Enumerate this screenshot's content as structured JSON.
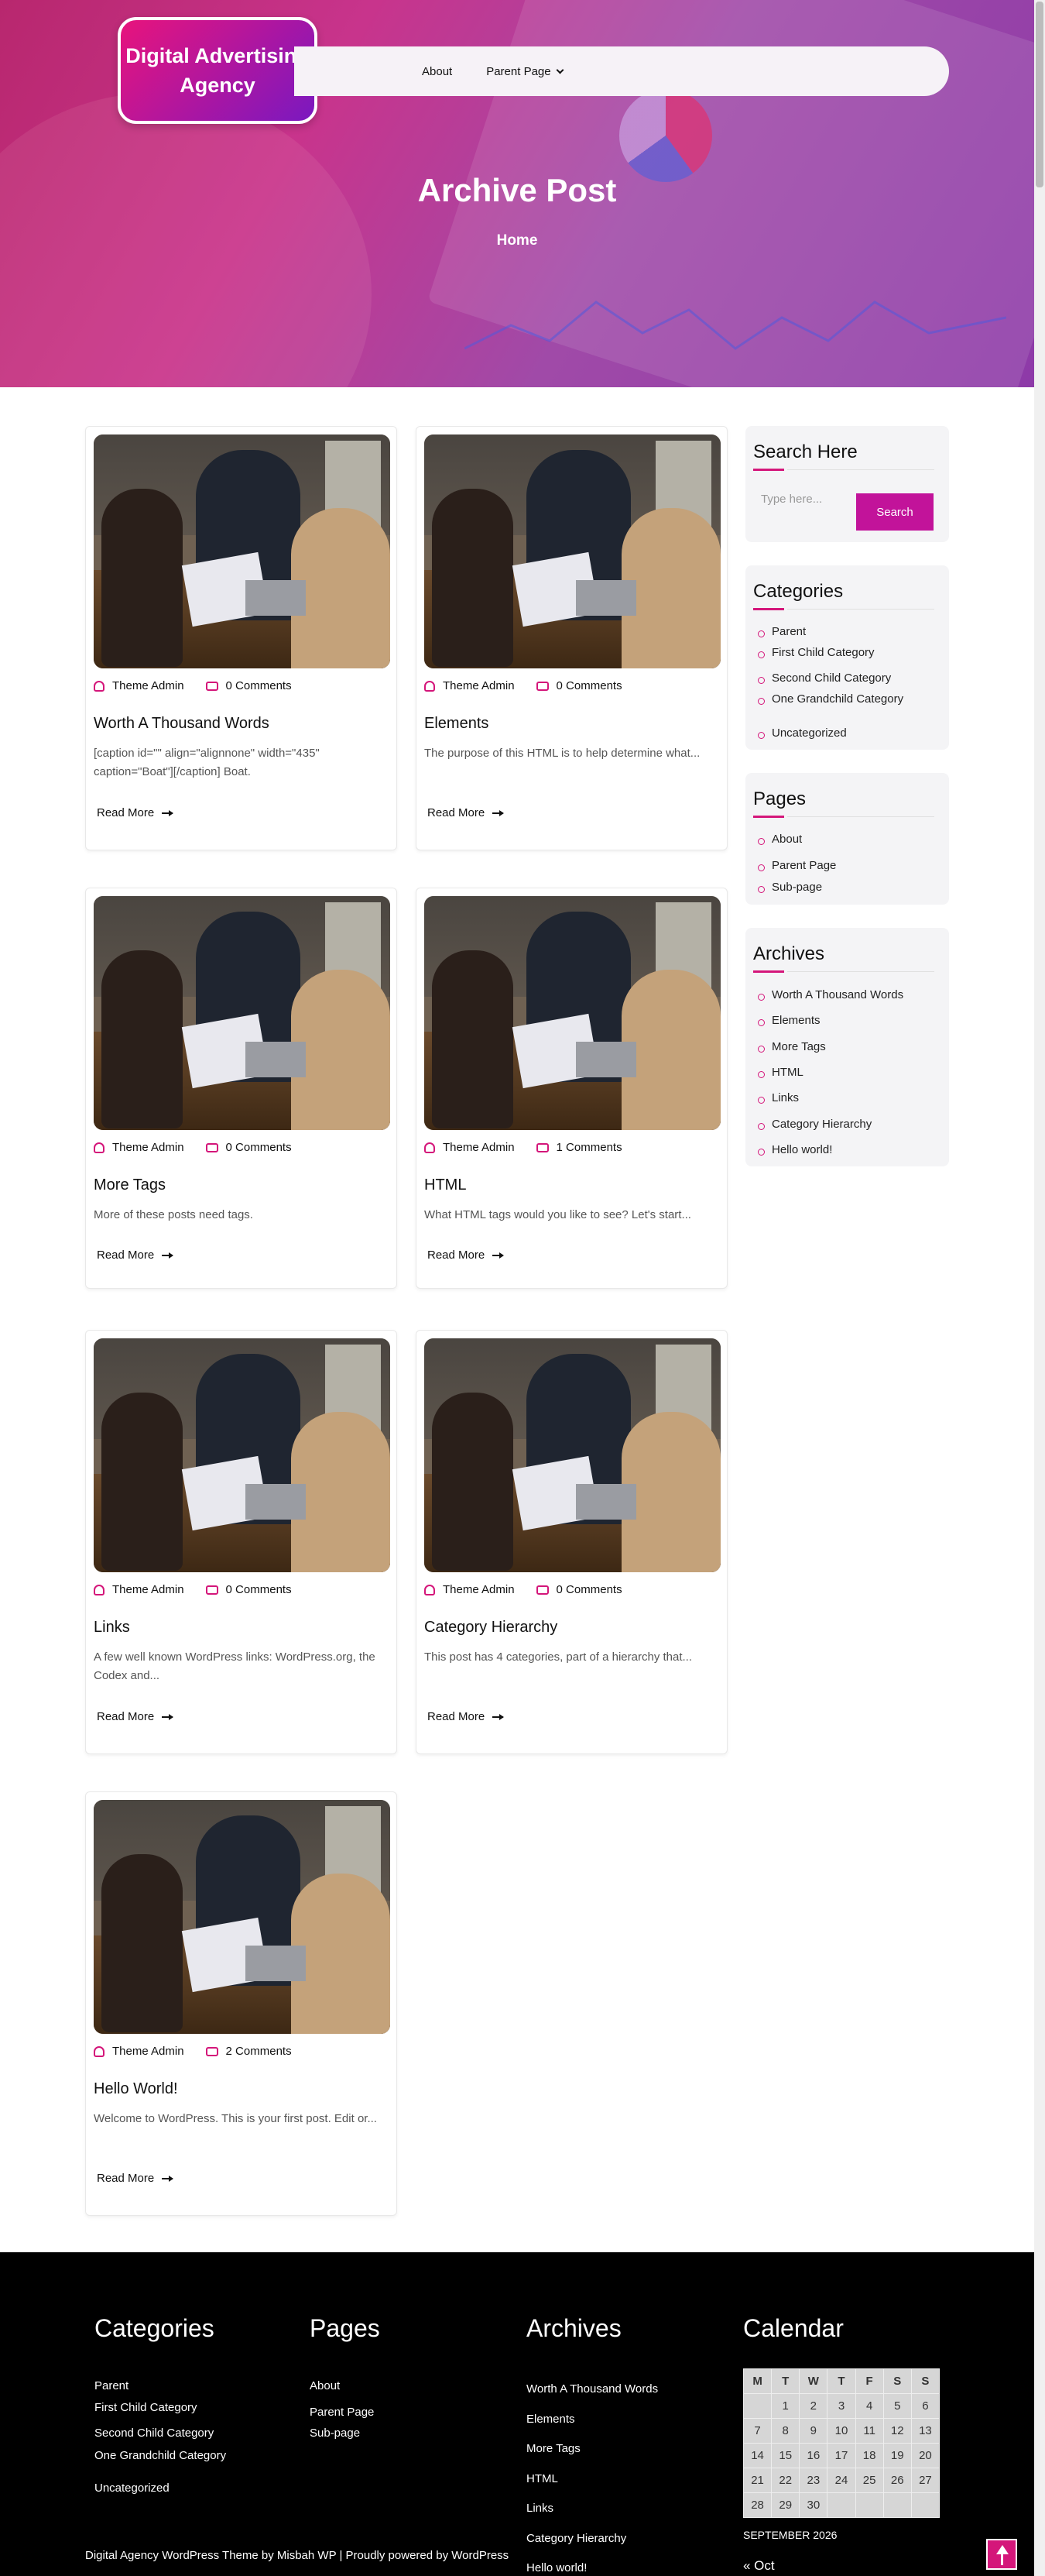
{
  "site": {
    "name": "Digital Advertising Agency"
  },
  "nav": {
    "items": [
      {
        "label": "About"
      },
      {
        "label": "Parent Page"
      }
    ]
  },
  "hero": {
    "title": "Archive Post",
    "breadcrumb": "Home"
  },
  "posts": [
    {
      "author": "Theme Admin",
      "comments": "0 Comments",
      "title": "Worth A Thousand Words",
      "excerpt": "[caption id=\"\" align=\"alignnone\" width=\"435\" caption=\"Boat\"][/caption] Boat.",
      "read_more": "Read More"
    },
    {
      "author": "Theme Admin",
      "comments": "0 Comments",
      "title": "Elements",
      "excerpt": "The purpose of this HTML is to help determine what...",
      "read_more": "Read More"
    },
    {
      "author": "Theme Admin",
      "comments": "0 Comments",
      "title": "More Tags",
      "excerpt": "More of these posts need tags.",
      "read_more": "Read More"
    },
    {
      "author": "Theme Admin",
      "comments": "1 Comments",
      "title": "HTML",
      "excerpt": "What HTML tags would you like to see? Let's start...",
      "read_more": "Read More"
    },
    {
      "author": "Theme Admin",
      "comments": "0 Comments",
      "title": "Links",
      "excerpt": "A few well known WordPress links: WordPress.org, the Codex and...",
      "read_more": "Read More"
    },
    {
      "author": "Theme Admin",
      "comments": "0 Comments",
      "title": "Category Hierarchy",
      "excerpt": "This post has 4 categories, part of a hierarchy that...",
      "read_more": "Read More"
    },
    {
      "author": "Theme Admin",
      "comments": "2 Comments",
      "title": "Hello World!",
      "excerpt": "Welcome to WordPress. This is your first post. Edit or...",
      "read_more": "Read More"
    }
  ],
  "sidebar": {
    "search": {
      "title": "Search Here",
      "placeholder": "Type here...",
      "button": "Search"
    },
    "categories": {
      "title": "Categories",
      "items": [
        "Parent",
        "First Child Category",
        "Second Child Category",
        "One Grandchild Category",
        "Uncategorized"
      ]
    },
    "pages": {
      "title": "Pages",
      "items": [
        "About",
        "Parent Page",
        "Sub-page"
      ]
    },
    "archives": {
      "title": "Archives",
      "items": [
        "Worth A Thousand Words",
        "Elements",
        "More Tags",
        "HTML",
        "Links",
        "Category Hierarchy",
        "Hello world!"
      ]
    }
  },
  "footer": {
    "categories": {
      "title": "Categories",
      "items": [
        "Parent",
        "First Child Category",
        "Second Child Category",
        "One Grandchild Category",
        "Uncategorized"
      ]
    },
    "pages": {
      "title": "Pages",
      "items": [
        "About",
        "Parent Page",
        "Sub-page"
      ]
    },
    "archives": {
      "title": "Archives",
      "items": [
        "Worth A Thousand Words",
        "Elements",
        "More Tags",
        "HTML",
        "Links",
        "Category Hierarchy",
        "Hello world!"
      ]
    },
    "calendar": {
      "title": "Calendar",
      "days": [
        "M",
        "T",
        "W",
        "T",
        "F",
        "S",
        "S"
      ],
      "weeks": [
        [
          "",
          "1",
          "2",
          "3",
          "4",
          "5",
          "6"
        ],
        [
          "7",
          "8",
          "9",
          "10",
          "11",
          "12",
          "13"
        ],
        [
          "14",
          "15",
          "16",
          "17",
          "18",
          "19",
          "20"
        ],
        [
          "21",
          "22",
          "23",
          "24",
          "25",
          "26",
          "27"
        ],
        [
          "28",
          "29",
          "30",
          "",
          "",
          "",
          ""
        ]
      ],
      "caption": "SEPTEMBER 2026",
      "prev": "« Oct"
    },
    "copyright": "Digital Agency WordPress Theme by Misbah WP | Proudly powered by WordPress"
  },
  "colors": {
    "accent": "#d4167a",
    "button": "#c2139a",
    "footer_bg": "#000000"
  }
}
